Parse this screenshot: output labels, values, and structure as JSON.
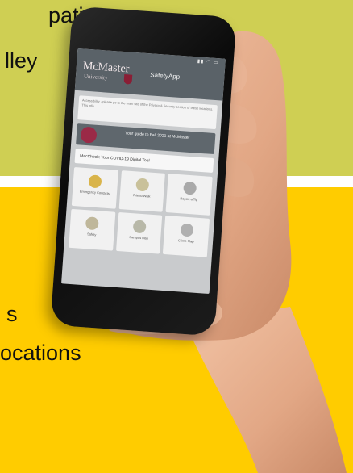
{
  "background_text": {
    "line1": "pation",
    "line2": "lley",
    "line3": "s",
    "line4": "ocations"
  },
  "colors": {
    "top_panel": "#cfcf53",
    "bottom_panel": "#ffcc00",
    "app_header": "#5a6268",
    "mcmaster_maroon": "#8a1e35"
  },
  "app": {
    "logo_main": "McMaster",
    "logo_sub": "University",
    "title": "SafetyApp",
    "notice_text": "Accessibility - please go to the main site of the Privacy & Security section of these locations. This info...",
    "guide_text": "Your guide to Fall 2021 at McMaster",
    "covid_bar_text": "MacCheck: Your COVID-19 Digital Tool",
    "tiles": [
      {
        "label": "Emergency Contacts",
        "icon": "phone-icon"
      },
      {
        "label": "Friend Walk",
        "icon": "walk-icon"
      },
      {
        "label": "Report a Tip",
        "icon": "eye-icon"
      },
      {
        "label": "Safety",
        "icon": "tools-icon"
      },
      {
        "label": "Campus Map",
        "icon": "map-icon"
      },
      {
        "label": "Crime Map",
        "icon": "pin-icon"
      }
    ]
  }
}
